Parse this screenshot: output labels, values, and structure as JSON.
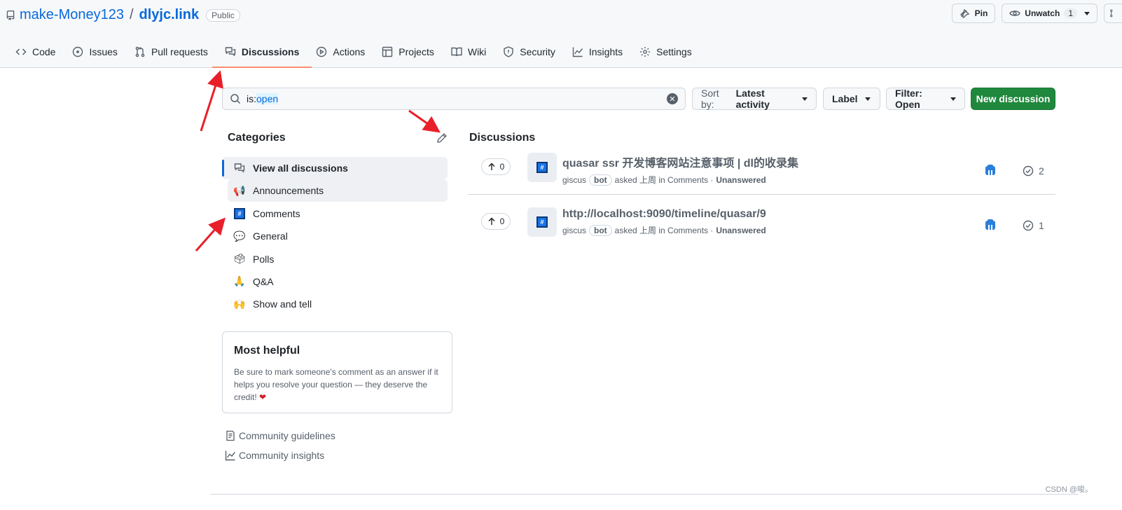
{
  "repo": {
    "owner": "make-Money123",
    "separator": "/",
    "name": "dlyjc.link",
    "visibility": "Public"
  },
  "header_actions": {
    "pin_label": "Pin",
    "unwatch_label": "Unwatch",
    "watch_count": "1"
  },
  "tabs": [
    {
      "label": "Code",
      "icon": "code-icon"
    },
    {
      "label": "Issues",
      "icon": "issue-opened-icon"
    },
    {
      "label": "Pull requests",
      "icon": "git-pull-request-icon"
    },
    {
      "label": "Discussions",
      "icon": "comment-discussion-icon",
      "selected": true
    },
    {
      "label": "Actions",
      "icon": "play-icon"
    },
    {
      "label": "Projects",
      "icon": "table-icon"
    },
    {
      "label": "Wiki",
      "icon": "book-icon"
    },
    {
      "label": "Security",
      "icon": "shield-icon"
    },
    {
      "label": "Insights",
      "icon": "graph-icon"
    },
    {
      "label": "Settings",
      "icon": "gear-icon"
    }
  ],
  "search": {
    "prefix": "is:",
    "value": "open"
  },
  "toolbar": {
    "sort_prefix": "Sort by:",
    "sort_value": "Latest activity",
    "label_button": "Label",
    "filter_label": "Filter: Open",
    "new_discussion": "New discussion"
  },
  "sidebar": {
    "categories_title": "Categories",
    "categories": [
      {
        "label": "View all discussions",
        "emoji": "comment-discussion-icon",
        "active": true
      },
      {
        "label": "Announcements",
        "emoji": "loudspeaker-emoji"
      },
      {
        "label": "Comments",
        "emoji": "hash-emoji"
      },
      {
        "label": "General",
        "emoji": "speech-balloon-emoji"
      },
      {
        "label": "Polls",
        "emoji": "ballot-box-emoji"
      },
      {
        "label": "Q&A",
        "emoji": "pray-emoji"
      },
      {
        "label": "Show and tell",
        "emoji": "raising-hands-emoji"
      }
    ],
    "most_helpful": {
      "title": "Most helpful",
      "text": "Be sure to mark someone's comment as an answer if it helps you resolve your question — they deserve the credit!"
    },
    "links": [
      {
        "label": "Community guidelines",
        "icon": "law-icon"
      },
      {
        "label": "Community insights",
        "icon": "graph-icon"
      }
    ]
  },
  "discussions": {
    "title": "Discussions",
    "items": [
      {
        "votes": "0",
        "title": "quasar ssr 开发博客网站注意事项 | dl的收录集",
        "author": "giscus",
        "author_badge": "bot",
        "asked": "asked 上周 in Comments ·",
        "status": "Unanswered",
        "comments": "2"
      },
      {
        "votes": "0",
        "title": "http://localhost:9090/timeline/quasar/9",
        "author": "giscus",
        "author_badge": "bot",
        "asked": "asked 上周 in Comments ·",
        "status": "Unanswered",
        "comments": "1"
      }
    ]
  },
  "watermark": "CSDN @唆。",
  "colors": {
    "accent_blue": "#0969da",
    "primary_green": "#1f883d",
    "selected_underline": "#fd8c73",
    "annotation_red": "#e8202a"
  }
}
